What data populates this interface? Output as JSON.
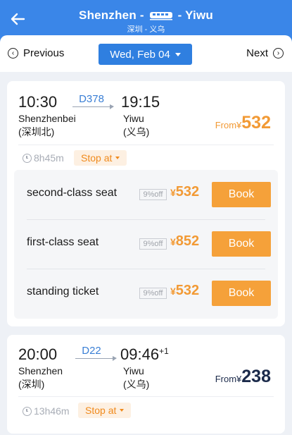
{
  "header": {
    "from_city": "Shenzhen",
    "to_city": "Yiwu",
    "dash": "-",
    "subtitle": "深圳 - 义乌",
    "bg_color": "#3a86e8"
  },
  "datebar": {
    "previous_label": "Previous",
    "next_label": "Next",
    "date": "Wed, Feb 04"
  },
  "trains": [
    {
      "depart_time": "10:30",
      "arrive_time": "19:15",
      "train_no": "D378",
      "depart_station": "Shenzhenbei",
      "depart_station_cn": "(深圳北)",
      "arrive_station": "Yiwu",
      "arrive_station_cn": "(义乌)",
      "from_label": "From¥",
      "from_price": "532",
      "duration": "8h45m",
      "stop_label": "Stop at",
      "seats": [
        {
          "name": "second-class seat",
          "discount": "9%off",
          "currency": "¥",
          "price": "532",
          "book": "Book"
        },
        {
          "name": "first-class seat",
          "discount": "9%off",
          "currency": "¥",
          "price": "852",
          "book": "Book"
        },
        {
          "name": "standing ticket",
          "discount": "9%off",
          "currency": "¥",
          "price": "532",
          "book": "Book"
        }
      ]
    },
    {
      "depart_time": "20:00",
      "arrive_time": "09:46",
      "arrive_day_offset": "+1",
      "train_no": "D22",
      "depart_station": "Shenzhen",
      "depart_station_cn": "(深圳)",
      "arrive_station": "Yiwu",
      "arrive_station_cn": "(义乌)",
      "from_label": "From¥",
      "from_price": "238",
      "duration": "13h46m",
      "stop_label": "Stop at"
    }
  ],
  "colors": {
    "accent_blue": "#2f7fe0",
    "price_orange": "#f29a35",
    "book_orange": "#f5a13a"
  },
  "icons": [
    "back-arrow-icon",
    "train-icon",
    "chevron-left-circle-icon",
    "chevron-right-circle-icon",
    "chevron-down-icon",
    "clock-icon"
  ]
}
